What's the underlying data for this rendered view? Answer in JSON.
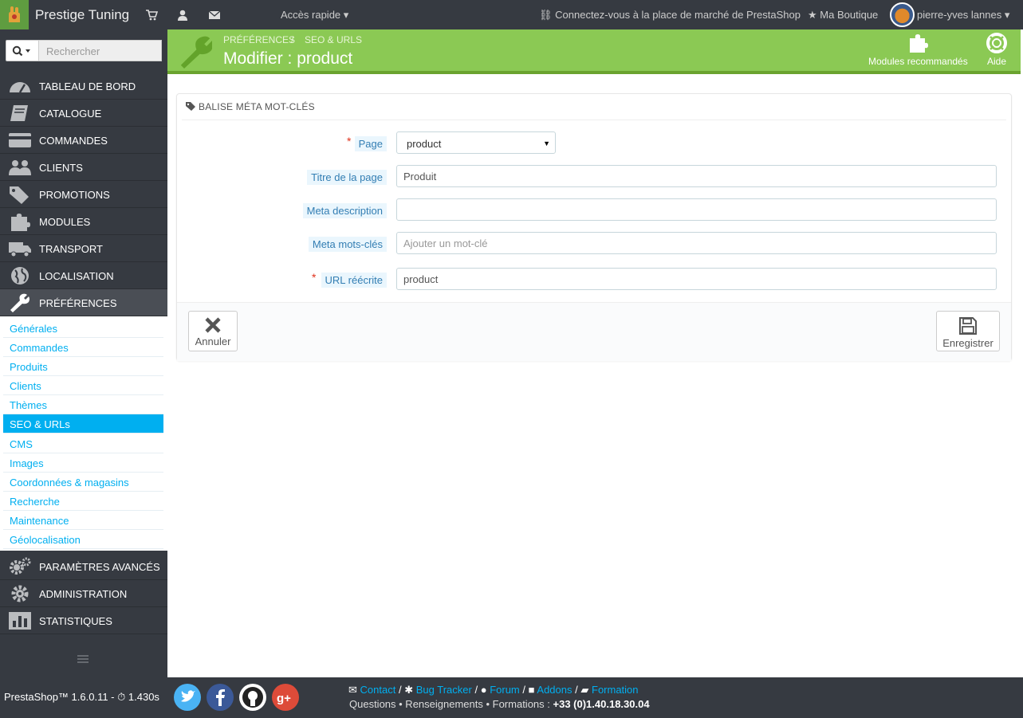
{
  "topbar": {
    "shop_name": "Prestige Tuning",
    "quick_access": "Accès rapide",
    "marketplace": "Connectez-vous à la place de marché de PrestaShop",
    "my_shop": "Ma Boutique",
    "user": "pierre-yves lannes"
  },
  "sidebar": {
    "search_placeholder": "Rechercher",
    "menu": [
      {
        "label": "TABLEAU DE BORD",
        "icon": "dashboard-icon"
      },
      {
        "label": "CATALOGUE",
        "icon": "book-icon"
      },
      {
        "label": "COMMANDES",
        "icon": "credit-card-icon"
      },
      {
        "label": "CLIENTS",
        "icon": "users-icon"
      },
      {
        "label": "PROMOTIONS",
        "icon": "tags-icon"
      },
      {
        "label": "MODULES",
        "icon": "puzzle-icon"
      },
      {
        "label": "TRANSPORT",
        "icon": "truck-icon"
      },
      {
        "label": "LOCALISATION",
        "icon": "globe-icon"
      },
      {
        "label": "PRÉFÉRENCES",
        "icon": "wrench-icon"
      },
      {
        "label": "PARAMÈTRES AVANCÉS",
        "icon": "cogs-icon"
      },
      {
        "label": "ADMINISTRATION",
        "icon": "cog-icon"
      },
      {
        "label": "STATISTIQUES",
        "icon": "bar-chart-icon"
      }
    ],
    "submenu": [
      {
        "label": "Générales"
      },
      {
        "label": "Commandes"
      },
      {
        "label": "Produits"
      },
      {
        "label": "Clients"
      },
      {
        "label": "Thèmes"
      },
      {
        "label": "SEO & URLs"
      },
      {
        "label": "CMS"
      },
      {
        "label": "Images"
      },
      {
        "label": "Coordonnées & magasins"
      },
      {
        "label": "Recherche"
      },
      {
        "label": "Maintenance"
      },
      {
        "label": "Géolocalisation"
      }
    ]
  },
  "header": {
    "breadcrumb_parent": "PRÉFÉRENCES",
    "breadcrumb_sep": "/",
    "breadcrumb_current": "SEO & URLS",
    "title": "Modifier : product",
    "modules_btn": "Modules recommandés",
    "help_btn": "Aide"
  },
  "panel": {
    "heading": "BALISE MÉTA MOT-CLÉS",
    "required_mark": "*",
    "fields": {
      "page": {
        "label": "Page",
        "value": "product"
      },
      "title": {
        "label": "Titre de la page",
        "value": "Produit"
      },
      "meta_desc": {
        "label": "Meta description",
        "value": ""
      },
      "meta_keywords": {
        "label": "Meta mots-clés",
        "placeholder": "Ajouter un mot-clé"
      },
      "url": {
        "label": "URL réécrite",
        "value": "product"
      }
    },
    "cancel": "Annuler",
    "save": "Enregistrer"
  },
  "footer": {
    "version": "PrestaShop™ 1.6.0.11 - ",
    "load_time": "1.430s",
    "links": [
      "Contact",
      "Bug Tracker",
      "Forum",
      "Addons",
      "Formation"
    ],
    "link_sep": "/",
    "contact_text": "Questions • Renseignements • Formations : ",
    "phone": "+33 (0)1.40.18.30.04"
  },
  "colors": {
    "header_green": "#8bc954",
    "accent_blue": "#00aff0",
    "dark": "#363a41"
  }
}
